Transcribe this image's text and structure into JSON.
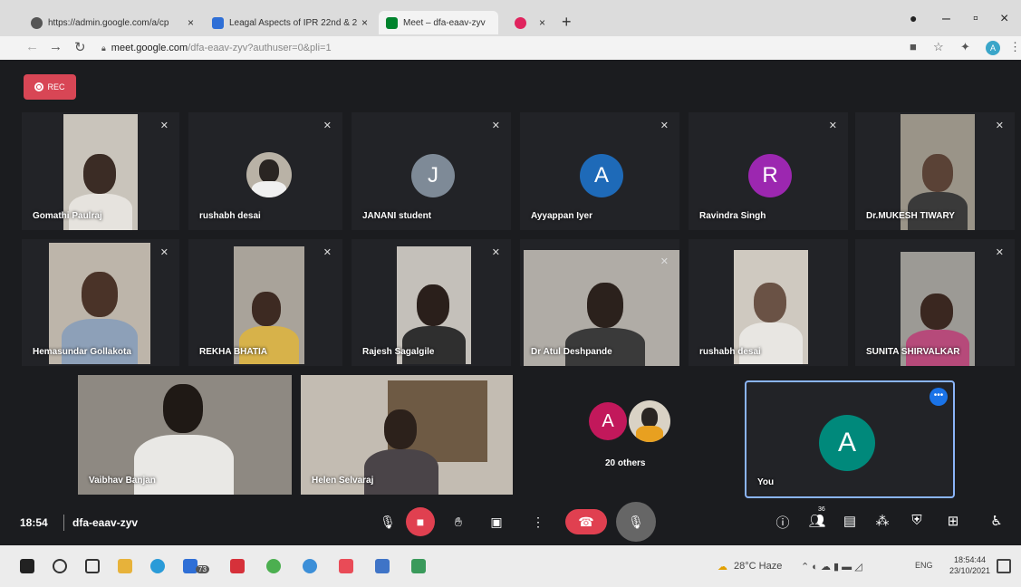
{
  "browser": {
    "tabs": [
      {
        "label": "https://admin.google.com/a/cp",
        "close": "×"
      },
      {
        "label": "Leagal Aspects of IPR 22nd & 2",
        "close": "×"
      },
      {
        "label": "Meet – dfa-eaav-zyv",
        "close": ""
      },
      {
        "label": "",
        "close": "×"
      }
    ],
    "new_tab": "+",
    "url_host": "meet.google.com",
    "url_path": "/dfa-eaav-zyv?authuser=0&pli=1",
    "window_controls": {
      "minimize": "–",
      "maximize": "▫",
      "close": "×"
    }
  },
  "meet": {
    "rec_label": "REC",
    "participants": [
      {
        "name": "Gomathi Paulraj",
        "kind": "video"
      },
      {
        "name": "rushabh desai",
        "kind": "photo"
      },
      {
        "name": "JANANI student",
        "kind": "avatar",
        "initial": "J",
        "color": "#7e8a97"
      },
      {
        "name": "Ayyappan Iyer",
        "kind": "avatar",
        "initial": "A",
        "color": "#1e6ab8"
      },
      {
        "name": "Ravindra Singh",
        "kind": "avatar",
        "initial": "R",
        "color": "#9c27b0"
      },
      {
        "name": "Dr.MUKESH TIWARY",
        "kind": "video"
      },
      {
        "name": "Hemasundar Gollakota",
        "kind": "video"
      },
      {
        "name": "REKHA BHATIA",
        "kind": "video"
      },
      {
        "name": "Rajesh Sagalgile",
        "kind": "video"
      },
      {
        "name": "Dr Atul Deshpande",
        "kind": "video"
      },
      {
        "name": "rushabh desai",
        "kind": "video"
      },
      {
        "name": "SUNITA SHIRVALKAR",
        "kind": "video"
      },
      {
        "name": "Vaibhav Banjan",
        "kind": "video"
      },
      {
        "name": "Helen Selvaraj",
        "kind": "video"
      }
    ],
    "others": {
      "label": "20 others",
      "initial": "A",
      "color": "#c2185b"
    },
    "self": {
      "label": "You",
      "initial": "A",
      "color": "#00897b"
    },
    "time": "18:54",
    "code": "dfa-eaav-zyv",
    "people_count": "36"
  },
  "taskbar": {
    "weather": "28°C  Haze",
    "lang": "ENG",
    "time": "18:54:44",
    "date": "23/10/2021",
    "edge_badge": "73"
  }
}
